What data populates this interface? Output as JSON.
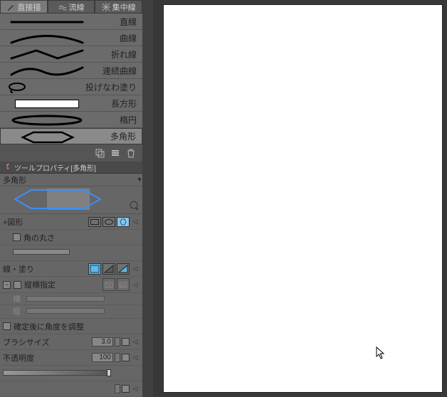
{
  "tabs": [
    {
      "label": "直接描",
      "glyph": "pencil"
    },
    {
      "label": "流線",
      "glyph": "stream"
    },
    {
      "label": "集中線",
      "glyph": "focus"
    }
  ],
  "tools": [
    {
      "id": "line",
      "label": "直線"
    },
    {
      "id": "curve",
      "label": "曲線"
    },
    {
      "id": "polyline",
      "label": "折れ線"
    },
    {
      "id": "contcurve",
      "label": "連続曲線"
    },
    {
      "id": "lasso",
      "label": "投げなわ塗り"
    },
    {
      "id": "rect",
      "label": "長方形"
    },
    {
      "id": "ellipse",
      "label": "楕円"
    },
    {
      "id": "polygon",
      "label": "多角形"
    }
  ],
  "active_tool_index": 7,
  "prop_header": "ツールプロパティ[多角形]",
  "prop_title": "多角形",
  "props": {
    "shape_section": "+図形",
    "corner_round": "角の丸さ",
    "line_fill": "線・塗り",
    "aspect_lock": "縦横指定",
    "aspect_h": "横",
    "aspect_v": "縦",
    "post_angle": "確定後に角度を調整",
    "brush_size": "ブラシサイズ",
    "brush_size_val": "3.0",
    "opacity": "不透明度",
    "opacity_val": "100"
  },
  "icons": {
    "wrench": "🔧",
    "dropdown": "▾",
    "plus": "+"
  }
}
